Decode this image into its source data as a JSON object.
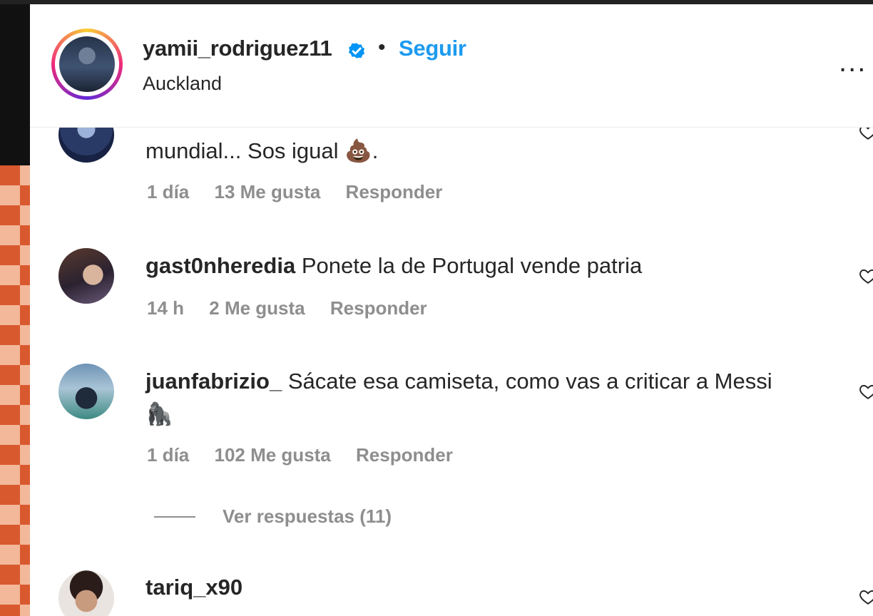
{
  "post_header": {
    "username": "yamii_rodriguez11",
    "separator": "•",
    "follow_label": "Seguir",
    "location": "Auckland",
    "more_label": "..."
  },
  "comments": [
    {
      "username": "",
      "text": "mundial... Sos igual 💩.",
      "time": "1 día",
      "likes": "13 Me gusta",
      "reply_label": "Responder"
    },
    {
      "username": "gast0nheredia",
      "text": "Ponete la de Portugal vende patria",
      "time": "14 h",
      "likes": "2 Me gusta",
      "reply_label": "Responder"
    },
    {
      "username": "juanfabrizio_",
      "text": "Sácate esa camiseta, como vas a criticar a Messi",
      "text_line2": "🦍",
      "time": "1 día",
      "likes": "102 Me gusta",
      "reply_label": "Responder",
      "view_replies": "Ver respuestas (11)"
    },
    {
      "username": "tariq_x90",
      "text": ""
    }
  ],
  "colors": {
    "follow_blue": "#1d9bf0",
    "text": "#262626",
    "muted": "#8e8e8e",
    "verified_blue": "#0095f6"
  },
  "icons": [
    "verified-badge-icon",
    "more-options-icon",
    "heart-icon"
  ]
}
